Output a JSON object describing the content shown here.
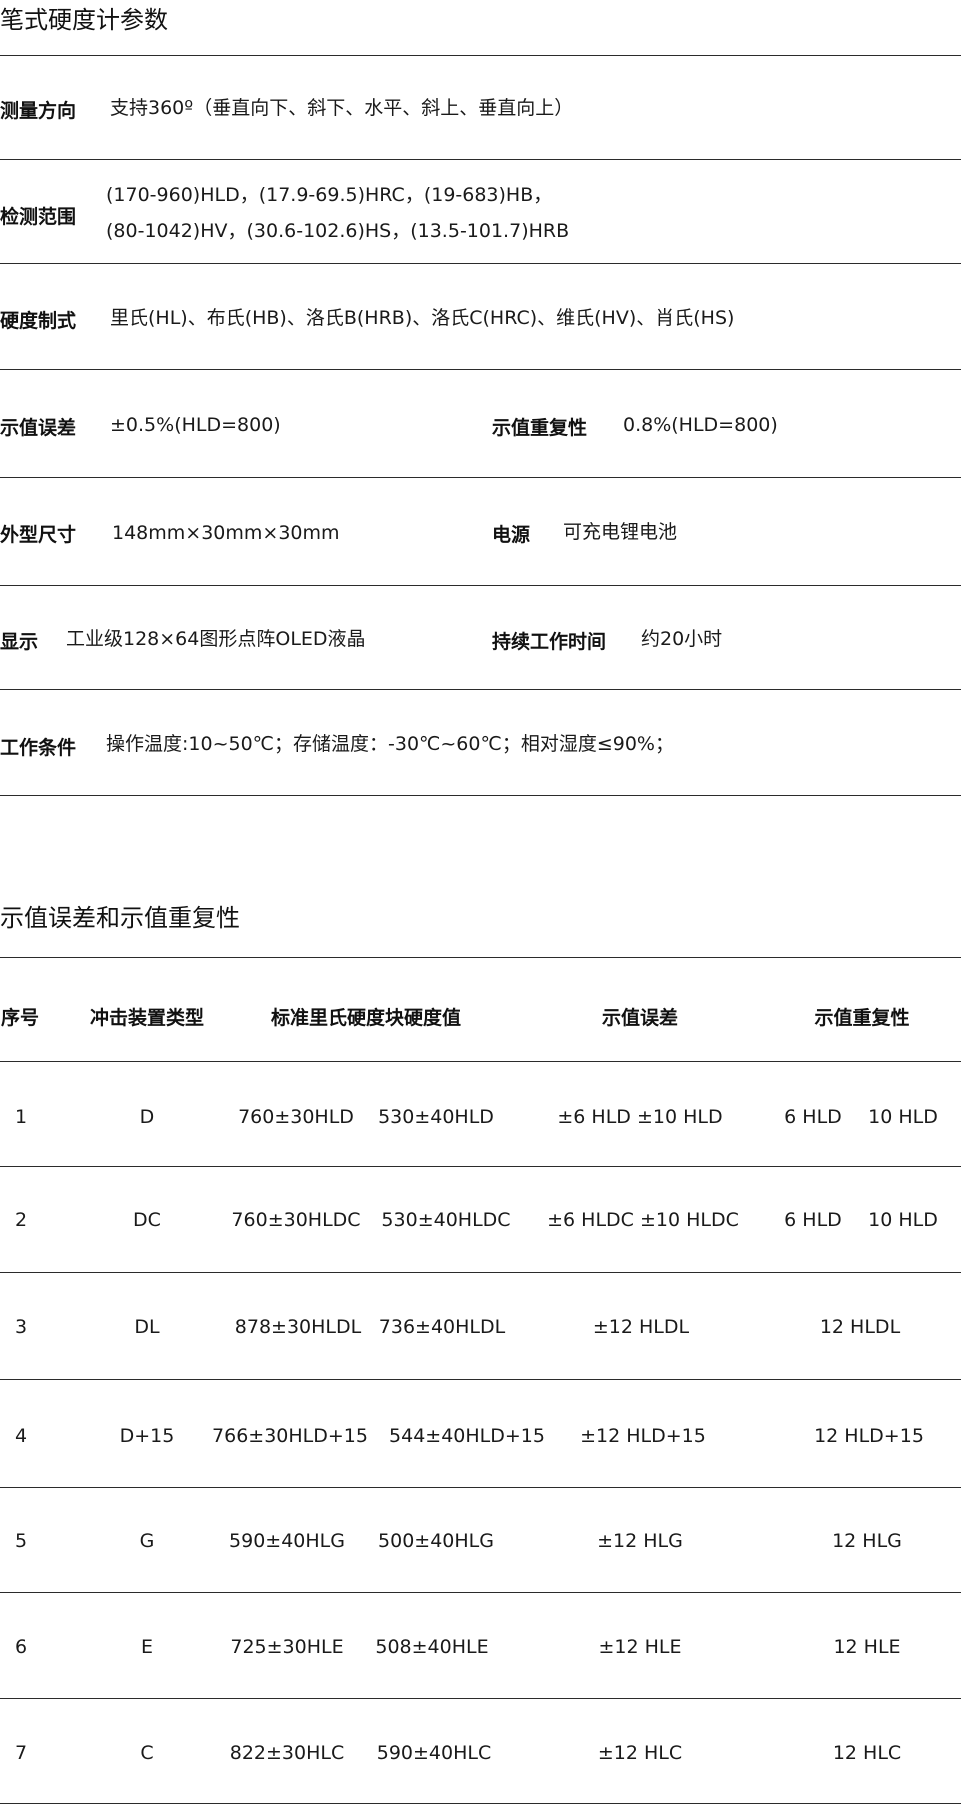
{
  "spec": {
    "title": "笔式硬度计参数",
    "rows": [
      {
        "label": "测量方向",
        "value": "支持360º（垂直向下、斜下、水平、斜上、垂直向上）"
      },
      {
        "label": "检测范围",
        "value_line1": "(170-960)HLD，(17.9-69.5)HRC，(19-683)HB，",
        "value_line2": "(80-1042)HV，(30.6-102.6)HS，(13.5-101.7)HRB"
      },
      {
        "label": "硬度制式",
        "value": "里氏(HL)、布氏(HB)、洛氏B(HRB)、洛氏C(HRC)、维氏(HV)、肖氏(HS)"
      },
      {
        "label": "示值误差",
        "value": "±0.5%(HLD=800)",
        "label2": "示值重复性",
        "value2": "0.8%(HLD=800)"
      },
      {
        "label": "外型尺寸",
        "value": "148mm×30mm×30mm",
        "label2": "电源",
        "value2": "可充电锂电池"
      },
      {
        "label": "显示",
        "value": "工业级128×64图形点阵OLED液晶",
        "label2": "持续工作时间",
        "value2": "约20小时"
      },
      {
        "label": "工作条件",
        "value": "操作温度:10~50℃；存储温度：-30℃~60℃；相对湿度≤90%；"
      }
    ]
  },
  "error_table": {
    "title": "示值误差和示值重复性",
    "headers": [
      "序号",
      "冲击装置类型",
      "标准里氏硬度块硬度值",
      "示值误差",
      "示值重复性"
    ],
    "rows": [
      {
        "no": "1",
        "device": "D",
        "std1": "760±30HLD",
        "std2": "530±40HLD",
        "err": "±6 HLD ±10 HLD",
        "rep1": "6 HLD",
        "rep2": "10 HLD"
      },
      {
        "no": "2",
        "device": "DC",
        "std1": "760±30HLDC",
        "std2": "530±40HLDC",
        "err": "±6 HLDC ±10 HLDC",
        "rep1": "6 HLD",
        "rep2": "10 HLD"
      },
      {
        "no": "3",
        "device": "DL",
        "std1": "878±30HLDL",
        "std2": "736±40HLDL",
        "err": "±12 HLDL",
        "rep": "12 HLDL"
      },
      {
        "no": "4",
        "device": "D+15",
        "std1": "766±30HLD+15",
        "std2": "544±40HLD+15",
        "err": "±12 HLD+15",
        "rep": "12 HLD+15"
      },
      {
        "no": "5",
        "device": "G",
        "std1": "590±40HLG",
        "std2": "500±40HLG",
        "err": "±12 HLG",
        "rep": "12 HLG"
      },
      {
        "no": "6",
        "device": "E",
        "std1": "725±30HLE",
        "std2": "508±40HLE",
        "err": "±12 HLE",
        "rep": "12 HLE"
      },
      {
        "no": "7",
        "device": "C",
        "std1": "822±30HLC",
        "std2": "590±40HLC",
        "err": "±12 HLC",
        "rep": "12 HLC"
      }
    ]
  }
}
